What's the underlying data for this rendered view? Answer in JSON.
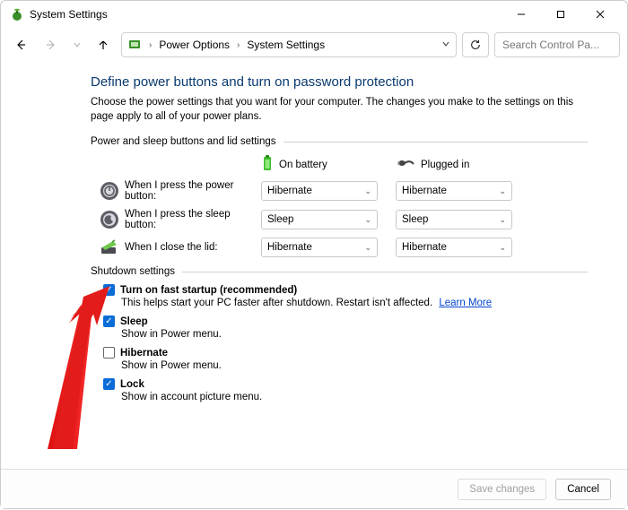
{
  "window": {
    "title": "System Settings"
  },
  "breadcrumb": {
    "item1": "Power Options",
    "item2": "System Settings",
    "chev": "›"
  },
  "search": {
    "placeholder": "Search Control Pa..."
  },
  "page": {
    "heading": "Define power buttons and turn on password protection",
    "subtext": "Choose the power settings that you want for your computer. The changes you make to the settings on this page apply to all of your power plans."
  },
  "power_section": {
    "label": "Power and sleep buttons and lid settings",
    "cols": {
      "battery": "On battery",
      "plugged": "Plugged in"
    },
    "rows": [
      {
        "label": "When I press the power button:",
        "battery": "Hibernate",
        "plugged": "Hibernate"
      },
      {
        "label": "When I press the sleep button:",
        "battery": "Sleep",
        "plugged": "Sleep"
      },
      {
        "label": "When I close the lid:",
        "battery": "Hibernate",
        "plugged": "Hibernate"
      }
    ]
  },
  "shutdown_section": {
    "label": "Shutdown settings",
    "items": {
      "fast_startup": {
        "title": "Turn on fast startup (recommended)",
        "desc": "This helps start your PC faster after shutdown. Restart isn't affected.",
        "link": "Learn More"
      },
      "sleep": {
        "title": "Sleep",
        "desc": "Show in Power menu."
      },
      "hibernate": {
        "title": "Hibernate",
        "desc": "Show in Power menu."
      },
      "lock": {
        "title": "Lock",
        "desc": "Show in account picture menu."
      }
    }
  },
  "footer": {
    "save": "Save changes",
    "cancel": "Cancel"
  }
}
